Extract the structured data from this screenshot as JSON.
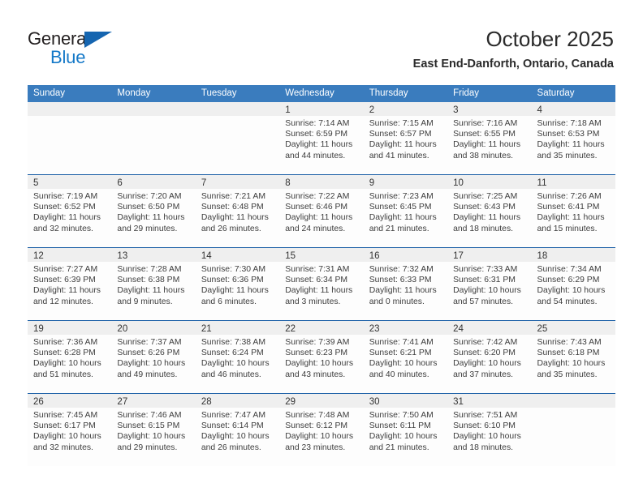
{
  "brand": {
    "name_part1": "General",
    "name_part2": "Blue",
    "triangle_icon": "triangle-icon",
    "accent_color": "#1579c8"
  },
  "header": {
    "title": "October 2025",
    "subtitle": "East End-Danforth, Ontario, Canada"
  },
  "theme": {
    "weekday_header_bg": "#3a7cbe",
    "week_divider": "#1f62a8",
    "day_strip_bg": "#efefef"
  },
  "weekdays": [
    "Sunday",
    "Monday",
    "Tuesday",
    "Wednesday",
    "Thursday",
    "Friday",
    "Saturday"
  ],
  "weeks": [
    {
      "days": [
        {
          "num": "",
          "lines": []
        },
        {
          "num": "",
          "lines": []
        },
        {
          "num": "",
          "lines": []
        },
        {
          "num": "1",
          "lines": [
            "Sunrise: 7:14 AM",
            "Sunset: 6:59 PM",
            "Daylight: 11 hours",
            "and 44 minutes."
          ]
        },
        {
          "num": "2",
          "lines": [
            "Sunrise: 7:15 AM",
            "Sunset: 6:57 PM",
            "Daylight: 11 hours",
            "and 41 minutes."
          ]
        },
        {
          "num": "3",
          "lines": [
            "Sunrise: 7:16 AM",
            "Sunset: 6:55 PM",
            "Daylight: 11 hours",
            "and 38 minutes."
          ]
        },
        {
          "num": "4",
          "lines": [
            "Sunrise: 7:18 AM",
            "Sunset: 6:53 PM",
            "Daylight: 11 hours",
            "and 35 minutes."
          ]
        }
      ]
    },
    {
      "days": [
        {
          "num": "5",
          "lines": [
            "Sunrise: 7:19 AM",
            "Sunset: 6:52 PM",
            "Daylight: 11 hours",
            "and 32 minutes."
          ]
        },
        {
          "num": "6",
          "lines": [
            "Sunrise: 7:20 AM",
            "Sunset: 6:50 PM",
            "Daylight: 11 hours",
            "and 29 minutes."
          ]
        },
        {
          "num": "7",
          "lines": [
            "Sunrise: 7:21 AM",
            "Sunset: 6:48 PM",
            "Daylight: 11 hours",
            "and 26 minutes."
          ]
        },
        {
          "num": "8",
          "lines": [
            "Sunrise: 7:22 AM",
            "Sunset: 6:46 PM",
            "Daylight: 11 hours",
            "and 24 minutes."
          ]
        },
        {
          "num": "9",
          "lines": [
            "Sunrise: 7:23 AM",
            "Sunset: 6:45 PM",
            "Daylight: 11 hours",
            "and 21 minutes."
          ]
        },
        {
          "num": "10",
          "lines": [
            "Sunrise: 7:25 AM",
            "Sunset: 6:43 PM",
            "Daylight: 11 hours",
            "and 18 minutes."
          ]
        },
        {
          "num": "11",
          "lines": [
            "Sunrise: 7:26 AM",
            "Sunset: 6:41 PM",
            "Daylight: 11 hours",
            "and 15 minutes."
          ]
        }
      ]
    },
    {
      "days": [
        {
          "num": "12",
          "lines": [
            "Sunrise: 7:27 AM",
            "Sunset: 6:39 PM",
            "Daylight: 11 hours",
            "and 12 minutes."
          ]
        },
        {
          "num": "13",
          "lines": [
            "Sunrise: 7:28 AM",
            "Sunset: 6:38 PM",
            "Daylight: 11 hours",
            "and 9 minutes."
          ]
        },
        {
          "num": "14",
          "lines": [
            "Sunrise: 7:30 AM",
            "Sunset: 6:36 PM",
            "Daylight: 11 hours",
            "and 6 minutes."
          ]
        },
        {
          "num": "15",
          "lines": [
            "Sunrise: 7:31 AM",
            "Sunset: 6:34 PM",
            "Daylight: 11 hours",
            "and 3 minutes."
          ]
        },
        {
          "num": "16",
          "lines": [
            "Sunrise: 7:32 AM",
            "Sunset: 6:33 PM",
            "Daylight: 11 hours",
            "and 0 minutes."
          ]
        },
        {
          "num": "17",
          "lines": [
            "Sunrise: 7:33 AM",
            "Sunset: 6:31 PM",
            "Daylight: 10 hours",
            "and 57 minutes."
          ]
        },
        {
          "num": "18",
          "lines": [
            "Sunrise: 7:34 AM",
            "Sunset: 6:29 PM",
            "Daylight: 10 hours",
            "and 54 minutes."
          ]
        }
      ]
    },
    {
      "days": [
        {
          "num": "19",
          "lines": [
            "Sunrise: 7:36 AM",
            "Sunset: 6:28 PM",
            "Daylight: 10 hours",
            "and 51 minutes."
          ]
        },
        {
          "num": "20",
          "lines": [
            "Sunrise: 7:37 AM",
            "Sunset: 6:26 PM",
            "Daylight: 10 hours",
            "and 49 minutes."
          ]
        },
        {
          "num": "21",
          "lines": [
            "Sunrise: 7:38 AM",
            "Sunset: 6:24 PM",
            "Daylight: 10 hours",
            "and 46 minutes."
          ]
        },
        {
          "num": "22",
          "lines": [
            "Sunrise: 7:39 AM",
            "Sunset: 6:23 PM",
            "Daylight: 10 hours",
            "and 43 minutes."
          ]
        },
        {
          "num": "23",
          "lines": [
            "Sunrise: 7:41 AM",
            "Sunset: 6:21 PM",
            "Daylight: 10 hours",
            "and 40 minutes."
          ]
        },
        {
          "num": "24",
          "lines": [
            "Sunrise: 7:42 AM",
            "Sunset: 6:20 PM",
            "Daylight: 10 hours",
            "and 37 minutes."
          ]
        },
        {
          "num": "25",
          "lines": [
            "Sunrise: 7:43 AM",
            "Sunset: 6:18 PM",
            "Daylight: 10 hours",
            "and 35 minutes."
          ]
        }
      ]
    },
    {
      "days": [
        {
          "num": "26",
          "lines": [
            "Sunrise: 7:45 AM",
            "Sunset: 6:17 PM",
            "Daylight: 10 hours",
            "and 32 minutes."
          ]
        },
        {
          "num": "27",
          "lines": [
            "Sunrise: 7:46 AM",
            "Sunset: 6:15 PM",
            "Daylight: 10 hours",
            "and 29 minutes."
          ]
        },
        {
          "num": "28",
          "lines": [
            "Sunrise: 7:47 AM",
            "Sunset: 6:14 PM",
            "Daylight: 10 hours",
            "and 26 minutes."
          ]
        },
        {
          "num": "29",
          "lines": [
            "Sunrise: 7:48 AM",
            "Sunset: 6:12 PM",
            "Daylight: 10 hours",
            "and 23 minutes."
          ]
        },
        {
          "num": "30",
          "lines": [
            "Sunrise: 7:50 AM",
            "Sunset: 6:11 PM",
            "Daylight: 10 hours",
            "and 21 minutes."
          ]
        },
        {
          "num": "31",
          "lines": [
            "Sunrise: 7:51 AM",
            "Sunset: 6:10 PM",
            "Daylight: 10 hours",
            "and 18 minutes."
          ]
        },
        {
          "num": "",
          "lines": []
        }
      ]
    }
  ]
}
